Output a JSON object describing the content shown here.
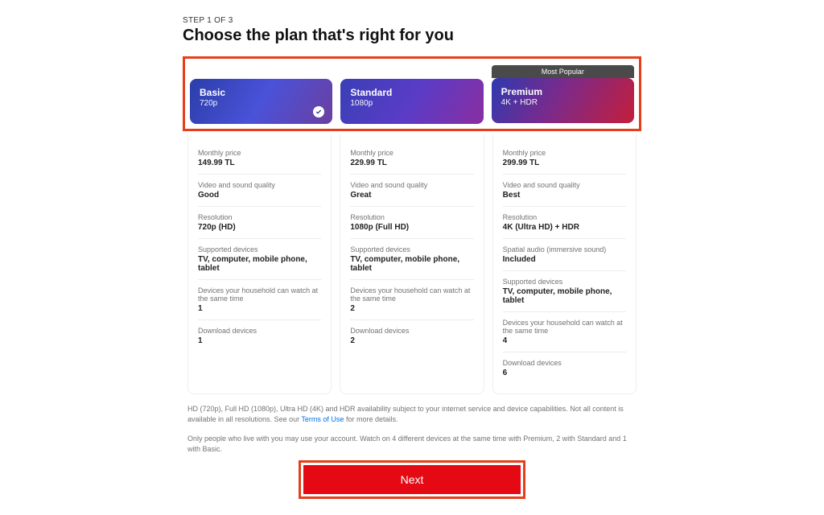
{
  "header": {
    "step_label": "STEP 1 OF 3",
    "title": "Choose the plan that's right for you"
  },
  "badges": {
    "popular": "Most Popular"
  },
  "plans": [
    {
      "name": "Basic",
      "resolution_short": "720p",
      "selected": true,
      "specs": [
        {
          "label": "Monthly price",
          "value": "149.99 TL"
        },
        {
          "label": "Video and sound quality",
          "value": "Good"
        },
        {
          "label": "Resolution",
          "value": "720p (HD)"
        },
        {
          "label": "Supported devices",
          "value": "TV, computer, mobile phone, tablet"
        },
        {
          "label": "Devices your household can watch at the same time",
          "value": "1"
        },
        {
          "label": "Download devices",
          "value": "1"
        }
      ]
    },
    {
      "name": "Standard",
      "resolution_short": "1080p",
      "selected": false,
      "specs": [
        {
          "label": "Monthly price",
          "value": "229.99 TL"
        },
        {
          "label": "Video and sound quality",
          "value": "Great"
        },
        {
          "label": "Resolution",
          "value": "1080p (Full HD)"
        },
        {
          "label": "Supported devices",
          "value": "TV, computer, mobile phone, tablet"
        },
        {
          "label": "Devices your household can watch at the same time",
          "value": "2"
        },
        {
          "label": "Download devices",
          "value": "2"
        }
      ]
    },
    {
      "name": "Premium",
      "resolution_short": "4K + HDR",
      "selected": false,
      "popular": true,
      "specs": [
        {
          "label": "Monthly price",
          "value": "299.99 TL"
        },
        {
          "label": "Video and sound quality",
          "value": "Best"
        },
        {
          "label": "Resolution",
          "value": "4K (Ultra HD) + HDR"
        },
        {
          "label": "Spatial audio (immersive sound)",
          "value": "Included"
        },
        {
          "label": "Supported devices",
          "value": "TV, computer, mobile phone, tablet"
        },
        {
          "label": "Devices your household can watch at the same time",
          "value": "4"
        },
        {
          "label": "Download devices",
          "value": "6"
        }
      ]
    }
  ],
  "disclaimer_line1_pre": "HD (720p), Full HD (1080p), Ultra HD (4K) and HDR availability subject to your internet service and device capabilities. Not all content is available in all resolutions. See our ",
  "disclaimer_terms": "Terms of Use",
  "disclaimer_line1_post": " for more details.",
  "disclaimer_line2": "Only people who live with you may use your account. Watch on 4 different devices at the same time with Premium, 2 with Standard and 1 with Basic.",
  "buttons": {
    "next": "Next"
  }
}
